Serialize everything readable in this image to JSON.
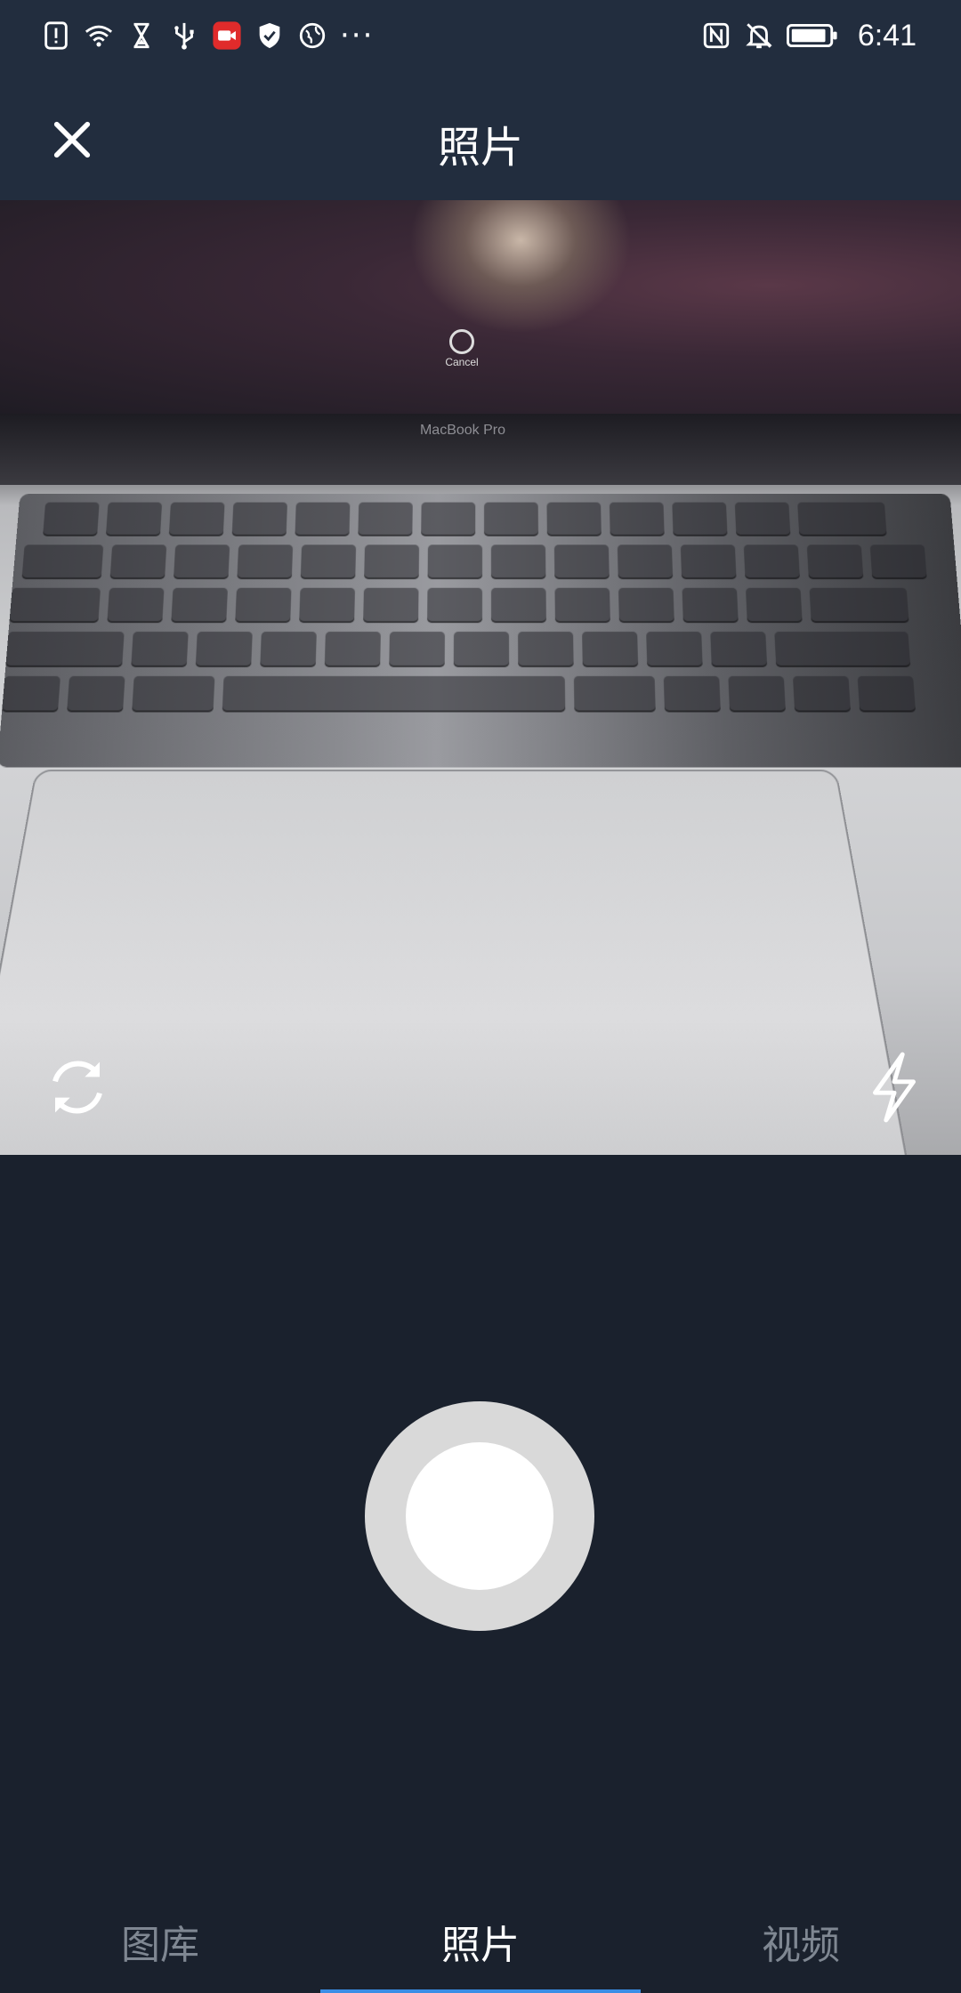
{
  "status_bar": {
    "left_icons": [
      "alert-icon",
      "wifi-icon",
      "hourglass-icon",
      "usb-icon",
      "screen-record-icon",
      "shield-icon",
      "globe-icon"
    ],
    "more": "···",
    "right_icons": [
      "nfc-icon",
      "bell-off-icon",
      "battery-icon"
    ],
    "time": "6:41",
    "record_color": "#e02b2b"
  },
  "header": {
    "title": "照片",
    "close_icon": "close-icon"
  },
  "preview": {
    "screen_text": "Cancel",
    "laptop_label": "MacBook Pro",
    "switch_camera_icon": "switch-camera-icon",
    "flash_icon": "flash-icon"
  },
  "shutter": {
    "icon": "shutter-button"
  },
  "tabs": [
    {
      "label": "图库",
      "active": false
    },
    {
      "label": "照片",
      "active": true
    },
    {
      "label": "视频",
      "active": false
    }
  ],
  "colors": {
    "header_bg": "#222d3e",
    "body_bg": "#1a212d",
    "tab_inactive": "#7f8792",
    "tab_indicator": "#3a8ee6"
  }
}
